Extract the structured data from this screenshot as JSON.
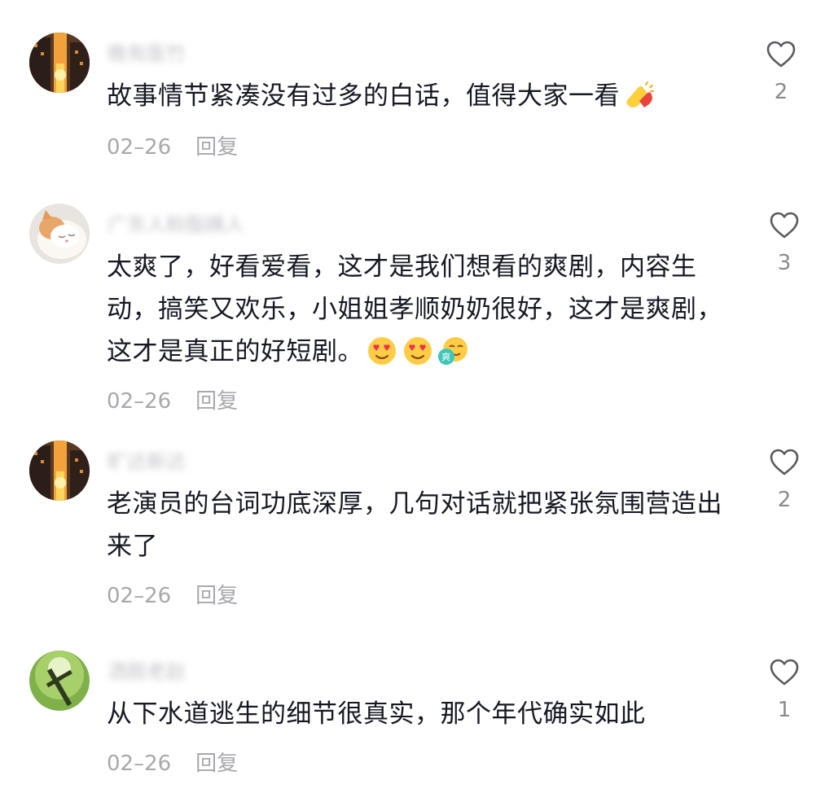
{
  "comments": [
    {
      "username": "晚有医竹",
      "text": "故事情节紧凑没有过多的白话，值得大家一看",
      "emojis": [
        "clap-emoji"
      ],
      "date": "02–26",
      "reply_label": "回复",
      "likes": "2",
      "avatar": "sunset-city-avatar"
    },
    {
      "username": "广东人粉脂姨人",
      "text": "太爽了，好看爱看，这才是我们想看的爽剧，内容生动，搞笑又欢乐，小姐姐孝顺奶奶很好，这才是爽剧，这才是真正的好短剧。",
      "emojis": [
        "heart-eyes-emoji",
        "heart-eyes-emoji",
        "shuang-emoji"
      ],
      "date": "02–26",
      "reply_label": "回复",
      "likes": "3",
      "avatar": "cat-avatar"
    },
    {
      "username": "旷达新达",
      "text": "老演员的台词功底深厚，几句对话就把紧张氛围营造出来了",
      "emojis": [],
      "date": "02–26",
      "reply_label": "回复",
      "likes": "2",
      "avatar": "sunset-city-avatar"
    },
    {
      "username": "洒脱老赵",
      "text": "从下水道逃生的细节很真实，那个年代确实如此",
      "emojis": [],
      "date": "02–26",
      "reply_label": "回复",
      "likes": "1",
      "avatar": "green-cross-avatar"
    }
  ],
  "colors": {
    "text": "#161823",
    "meta": "#a8a8ad",
    "icon": "#5a5a60"
  }
}
